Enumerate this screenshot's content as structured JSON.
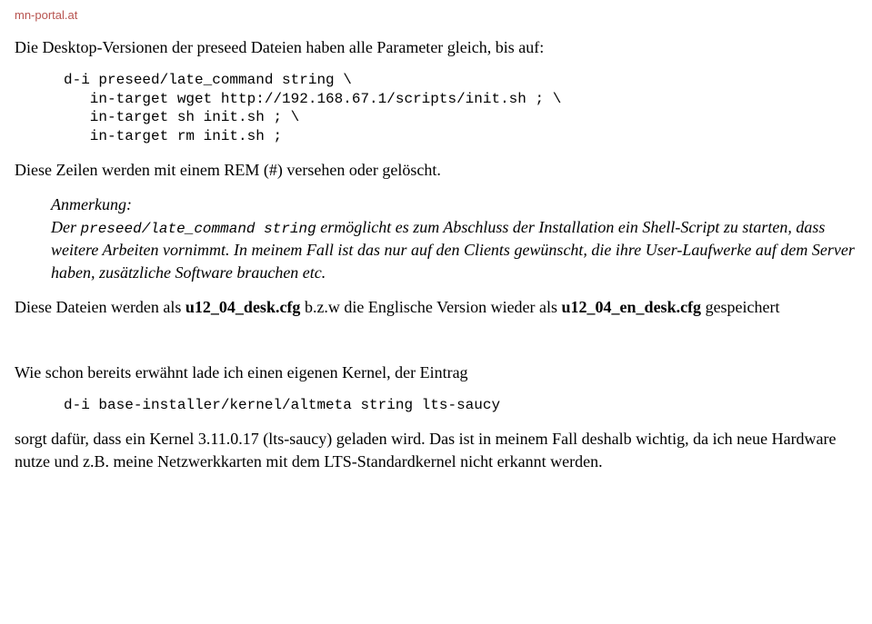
{
  "header": {
    "site": "mn-portal.at"
  },
  "body": {
    "p1": "Die Desktop-Versionen der preseed Dateien haben alle Parameter gleich, bis auf:",
    "code1": "d-i preseed/late_command string \\\n   in-target wget http://192.168.67.1/scripts/init.sh ; \\\n   in-target sh init.sh ; \\\n   in-target rm init.sh ;",
    "p2": "Diese Zeilen werden mit einem REM (#) versehen oder gelöscht.",
    "note": {
      "title": "Anmerkung:",
      "pre": "Der ",
      "code": "preseed/late_command string",
      "post": " ermöglicht es zum Abschluss der Installation ein Shell-Script zu starten, dass weitere Arbeiten vornimmt. In meinem Fall ist das nur auf den Clients gewünscht, die ihre User-Laufwerke auf dem Server haben, zusätzliche Software brauchen etc."
    },
    "p3": {
      "t1": "Diese Dateien werden als ",
      "b1": "u12_04_desk.cfg",
      "t2": " b.z.w die Englische Version wieder als ",
      "b2": "u12_04_en_desk.cfg",
      "t3": " gespeichert"
    },
    "p4": "Wie schon bereits erwähnt lade ich einen eigenen Kernel, der Eintrag",
    "code2": "d-i base-installer/kernel/altmeta string lts-saucy",
    "p5": "sorgt dafür, dass ein Kernel 3.11.0.17 (lts-saucy) geladen wird. Das ist in meinem Fall deshalb wichtig, da ich neue Hardware nutze und z.B. meine Netzwerkkarten mit dem LTS-Standardkernel nicht erkannt werden."
  }
}
